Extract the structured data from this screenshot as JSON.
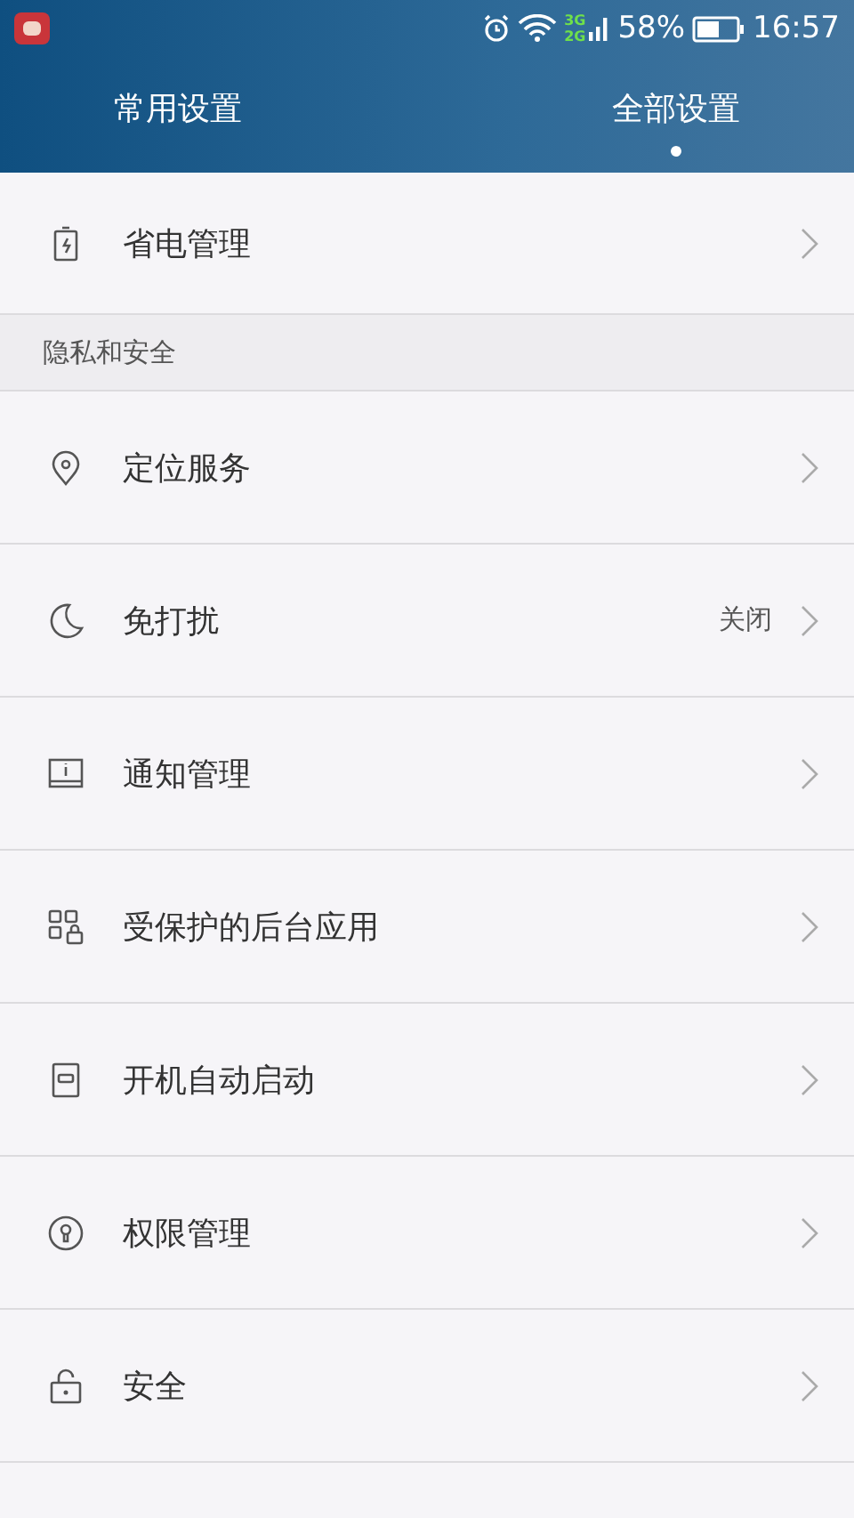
{
  "status_bar": {
    "network_top": "3G",
    "network_bottom": "2G",
    "battery": "58%",
    "time": "16:57"
  },
  "tabs": [
    {
      "label": "常用设置",
      "selected": false
    },
    {
      "label": "全部设置",
      "selected": true
    }
  ],
  "sections": [
    {
      "items": [
        {
          "label": "省电管理"
        }
      ]
    },
    {
      "header": "隐私和安全",
      "items": [
        {
          "label": "定位服务"
        },
        {
          "label": "免打扰",
          "value": "关闭"
        },
        {
          "label": "通知管理"
        },
        {
          "label": "受保护的后台应用"
        },
        {
          "label": "开机自动启动"
        },
        {
          "label": "权限管理"
        },
        {
          "label": "安全"
        }
      ]
    }
  ]
}
